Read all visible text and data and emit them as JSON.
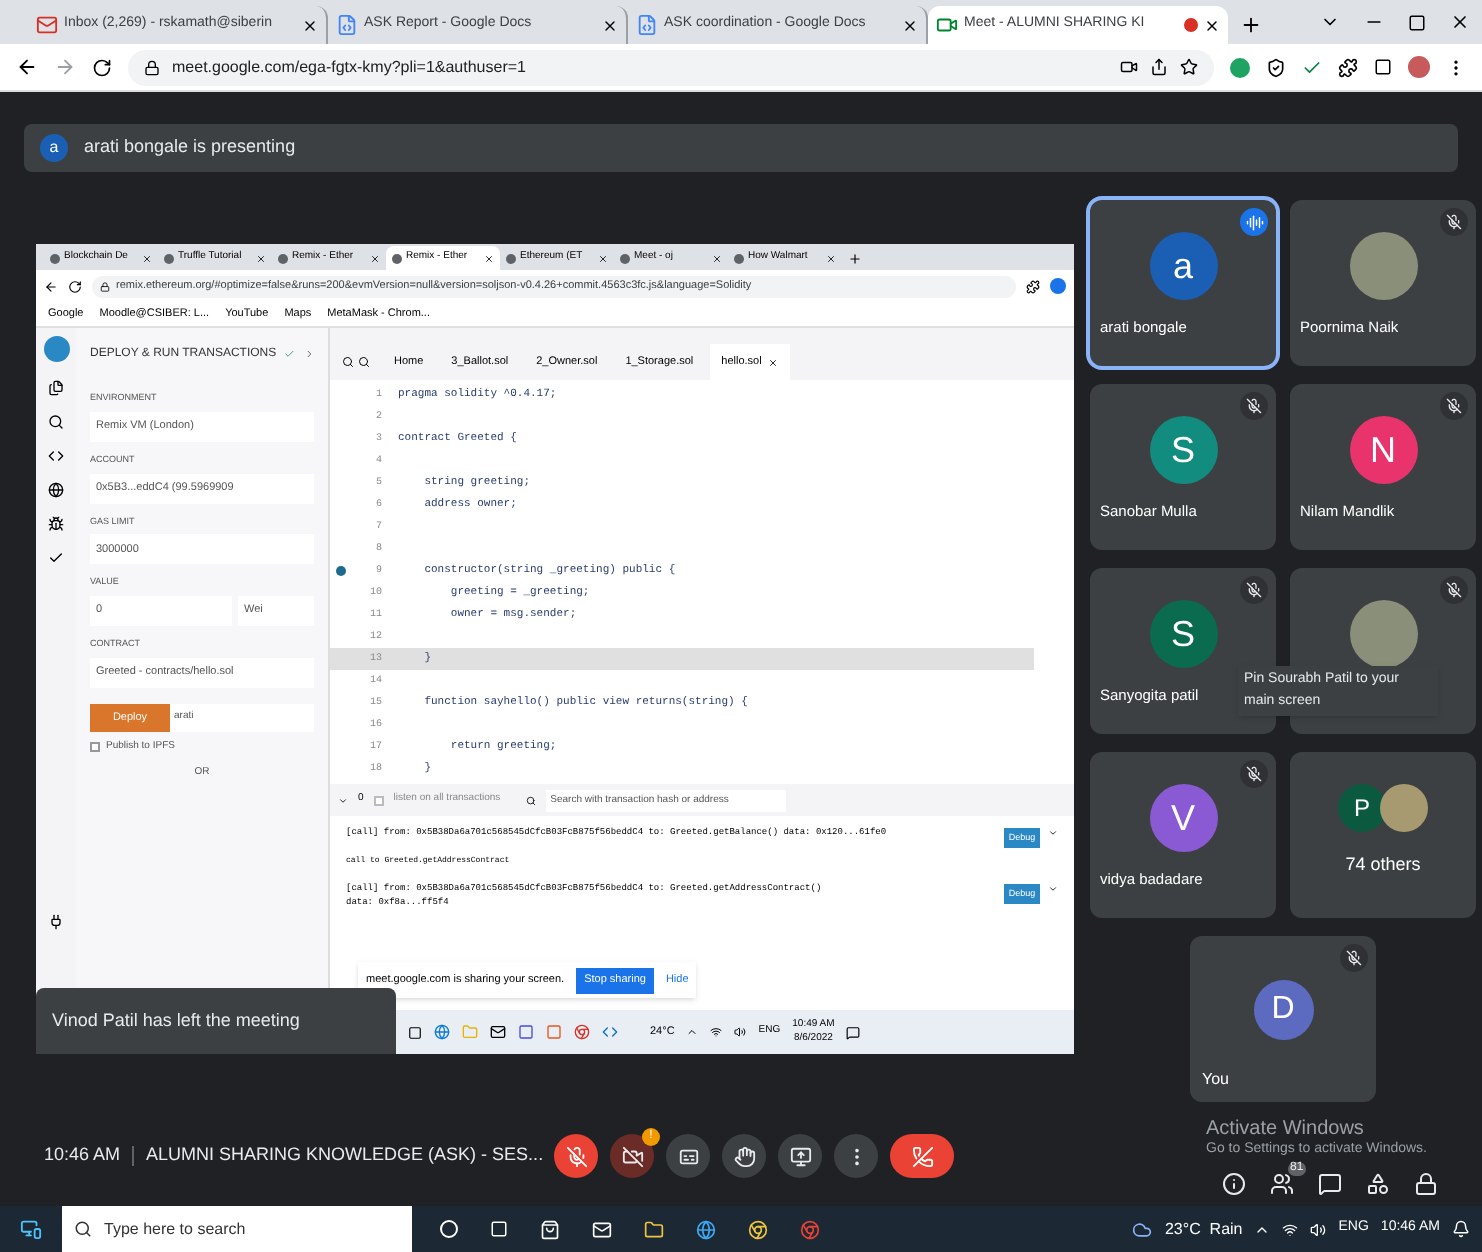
{
  "browser": {
    "tabs": [
      {
        "title": "Inbox (2,269) - rskamath@siberin",
        "kind": "mail",
        "selected": false
      },
      {
        "title": "ASK Report - Google Docs",
        "kind": "doc",
        "selected": false
      },
      {
        "title": "ASK coordination - Google Docs",
        "kind": "doc",
        "selected": false
      },
      {
        "title": "Meet - ALUMNI SHARING KI",
        "kind": "meet",
        "selected": true
      }
    ],
    "url": "meet.google.com/ega-fgtx-kmy?pli=1&authuser=1"
  },
  "presenting_banner": {
    "avatar": "a",
    "text": "arati bongale is presenting"
  },
  "shared_screen": {
    "tabs": [
      {
        "title": "Blockchain De",
        "selected": false
      },
      {
        "title": "Truffle Tutorial",
        "selected": false
      },
      {
        "title": "Remix - Ether",
        "selected": false
      },
      {
        "title": "Remix - Ether",
        "selected": true
      },
      {
        "title": "Ethereum (ET",
        "selected": false
      },
      {
        "title": "Meet - oj",
        "selected": false
      },
      {
        "title": "How Walmart",
        "selected": false
      }
    ],
    "url": "remix.ethereum.org/#optimize=false&runs=200&evmVersion=null&version=soljson-v0.4.26+commit.4563c3fc.js&language=Solidity",
    "bookmarks": [
      "Google",
      "Moodle@CSIBER: L...",
      "YouTube",
      "Maps",
      "MetaMask - Chrom..."
    ],
    "panel_title": "DEPLOY & RUN TRANSACTIONS",
    "fields": [
      {
        "label": "ENVIRONMENT",
        "value": "Remix VM (London)"
      },
      {
        "label": "ACCOUNT",
        "value": "0x5B3...eddC4 (99.5969909"
      },
      {
        "label": "GAS LIMIT",
        "value": "3000000"
      },
      {
        "label": "VALUE",
        "value": "0",
        "unit": "Wei"
      },
      {
        "label": "CONTRACT",
        "value": "Greeted - contracts/hello.sol"
      }
    ],
    "deploy_button": "Deploy",
    "deploy_argument": "arati",
    "publish": {
      "label": "Publish to IPFS",
      "checked": false
    },
    "or_label": "OR",
    "editor_tabs": [
      {
        "title": "Home",
        "selected": false
      },
      {
        "title": "3_Ballot.sol",
        "selected": false
      },
      {
        "title": "2_Owner.sol",
        "selected": false
      },
      {
        "title": "1_Storage.sol",
        "selected": false
      },
      {
        "title": "hello.sol",
        "selected": true
      }
    ],
    "code": [
      {
        "number": "1",
        "text": "pragma solidity ^0.4.17;",
        "highlighted": false,
        "breakpoint": false
      },
      {
        "number": "2",
        "highlighted": false,
        "breakpoint": false
      },
      {
        "number": "3",
        "text": "contract Greeted {",
        "highlighted": false,
        "breakpoint": false
      },
      {
        "number": "4",
        "highlighted": false,
        "breakpoint": false
      },
      {
        "number": "5",
        "text": "    string greeting;",
        "highlighted": false,
        "breakpoint": false
      },
      {
        "number": "6",
        "text": "    address owner;",
        "highlighted": false,
        "breakpoint": false
      },
      {
        "number": "7",
        "highlighted": false,
        "breakpoint": false
      },
      {
        "number": "8",
        "highlighted": false,
        "breakpoint": false
      },
      {
        "number": "9",
        "text": "    constructor(string _greeting) public {",
        "highlighted": false,
        "breakpoint": true
      },
      {
        "number": "10",
        "text": "        greeting = _greeting;",
        "highlighted": false,
        "breakpoint": false
      },
      {
        "number": "11",
        "text": "        owner = msg.sender;",
        "highlighted": false,
        "breakpoint": false
      },
      {
        "number": "12",
        "highlighted": false,
        "breakpoint": false
      },
      {
        "number": "13",
        "text": "    }",
        "highlighted": true,
        "breakpoint": false
      },
      {
        "number": "14",
        "highlighted": false,
        "breakpoint": false
      },
      {
        "number": "15",
        "text": "    function sayhello() public view returns(string) {",
        "highlighted": false,
        "breakpoint": false
      },
      {
        "number": "16",
        "highlighted": false,
        "breakpoint": false
      },
      {
        "number": "17",
        "text": "        return greeting;",
        "highlighted": false,
        "breakpoint": false
      },
      {
        "number": "18",
        "text": "    }",
        "highlighted": false,
        "breakpoint": false
      }
    ],
    "terminal": {
      "count": "0",
      "listen": {
        "label": "listen on all transactions",
        "checked": false
      },
      "search_placeholder": "Search with transaction hash or address"
    },
    "logs": [
      {
        "lines": [
          "[call] from: 0x5B38Da6a701c568545dCfcB03FcB875f56beddC4 to: Greeted.getBalance() data: 0x120...61fe0"
        ],
        "note": "call to Greeted.getAddressContract",
        "button": "Debug"
      },
      {
        "lines": [
          "[call] from: 0x5B38Da6a701c568545dCfcB03FcB875f56beddC4 to: Greeted.getAddressContract()",
          "data: 0xf8a...ff5f4"
        ],
        "button": "Debug"
      }
    ],
    "share_notice": {
      "text": "meet.google.com is sharing your screen.",
      "stop": "Stop sharing",
      "hide": "Hide"
    },
    "taskbar": {
      "weather": "24°C",
      "language": "ENG",
      "time": "10:49 AM",
      "date": "8/6/2022"
    }
  },
  "toast": "Vinod Patil has left the meeting",
  "participants": [
    {
      "name": "arati bongale",
      "kind": "letter",
      "letter": "a",
      "color": "#1a5fb4",
      "speaking": true,
      "muted": false
    },
    {
      "name": "Poornima Naik",
      "kind": "photo",
      "speaking": false,
      "muted": true
    },
    {
      "name": "Sanobar Mulla",
      "kind": "letter",
      "letter": "S",
      "color": "#128c7e",
      "speaking": false,
      "muted": true
    },
    {
      "name": "Nilam Mandlik",
      "kind": "letter",
      "letter": "N",
      "color": "#e8336d",
      "speaking": false,
      "muted": true
    },
    {
      "name": "Sanyogita patil",
      "kind": "letter",
      "letter": "S",
      "color": "#0b6b4f",
      "speaking": false,
      "muted": true
    },
    {
      "kind": "photo",
      "speaking": false,
      "muted": true,
      "tooltip": "Pin Sourabh Patil to your main screen"
    },
    {
      "name": "vidya badadare",
      "kind": "letter",
      "letter": "V",
      "color": "#8a5ad4",
      "speaking": false,
      "muted": true
    }
  ],
  "others": {
    "avatar": "P",
    "label": "74 others"
  },
  "self": {
    "name": "You",
    "letter": "D",
    "color": "#5c6bc0",
    "muted": true
  },
  "bottom_bar": {
    "time": "10:46 AM",
    "meeting_title": "ALUMNI SHARING KNOWLEDGE (ASK) - SES...",
    "controls": [
      {
        "kind": "mic",
        "on": false
      },
      {
        "kind": "camera",
        "on": false,
        "badge": "!"
      },
      {
        "kind": "captions",
        "on": false
      },
      {
        "kind": "hand",
        "on": false
      },
      {
        "kind": "present",
        "on": false
      },
      {
        "kind": "more",
        "on": false
      }
    ],
    "people_count": "81"
  },
  "os_notice": {
    "title": "Activate Windows",
    "text": "Go to Settings to activate Windows."
  },
  "taskbar": {
    "search_placeholder": "Type here to search",
    "weather": "23°C  Rain",
    "language": "ENG",
    "time": "10:46 AM"
  }
}
